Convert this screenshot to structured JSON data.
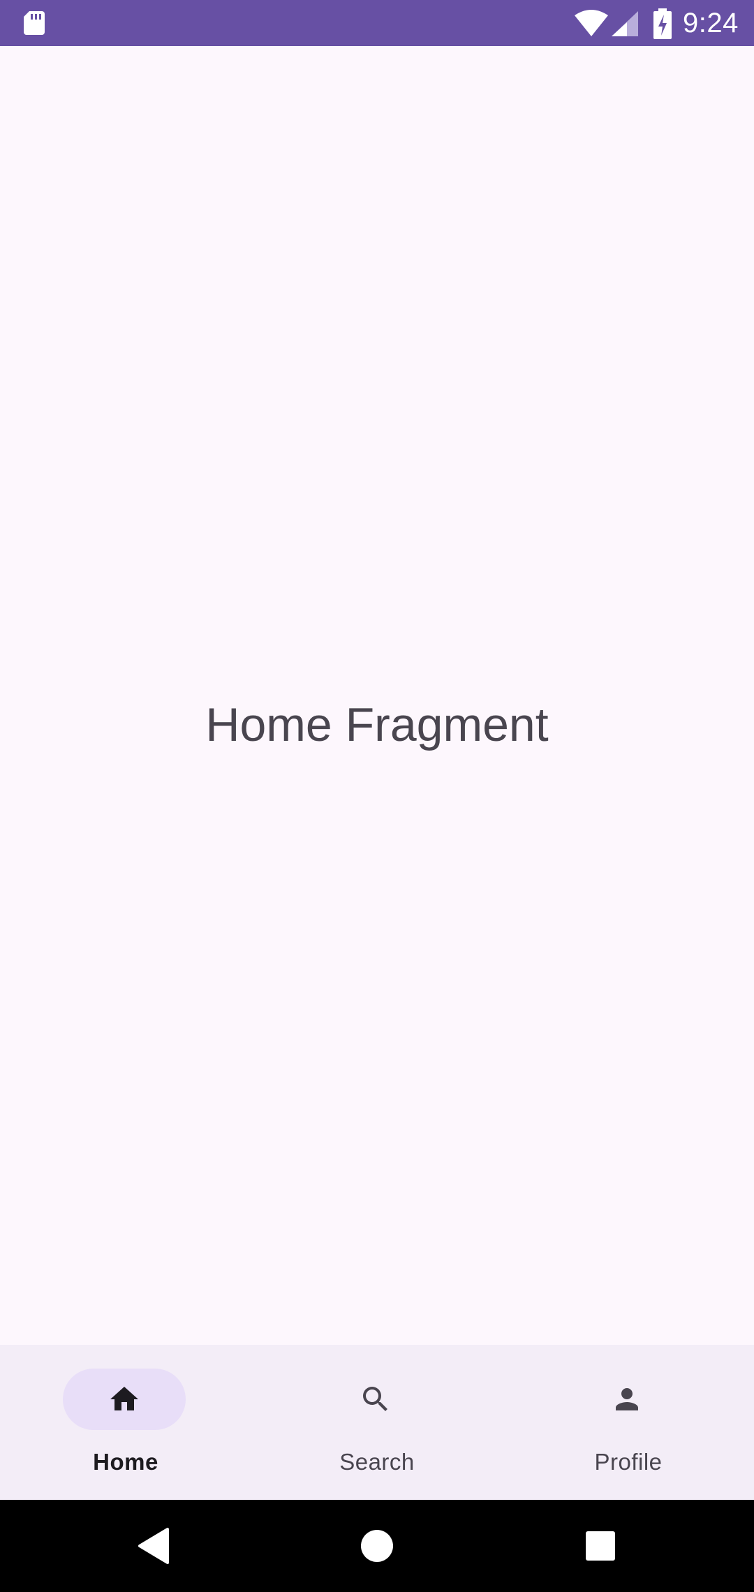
{
  "status_bar": {
    "time": "9:24",
    "icons": [
      "sd-card-icon",
      "wifi-icon",
      "cell-signal-icon",
      "battery-charging-icon"
    ],
    "background": "#6750A4"
  },
  "content": {
    "title": "Home Fragment"
  },
  "bottom_nav": {
    "items": [
      {
        "label": "Home",
        "icon": "home-icon",
        "active": true
      },
      {
        "label": "Search",
        "icon": "search-icon",
        "active": false
      },
      {
        "label": "Profile",
        "icon": "person-icon",
        "active": false
      }
    ],
    "background": "#F3EDF7",
    "indicator_color": "#E8DEF8"
  },
  "system_nav": {
    "buttons": [
      "back-icon",
      "home-circle-icon",
      "recents-square-icon"
    ]
  }
}
